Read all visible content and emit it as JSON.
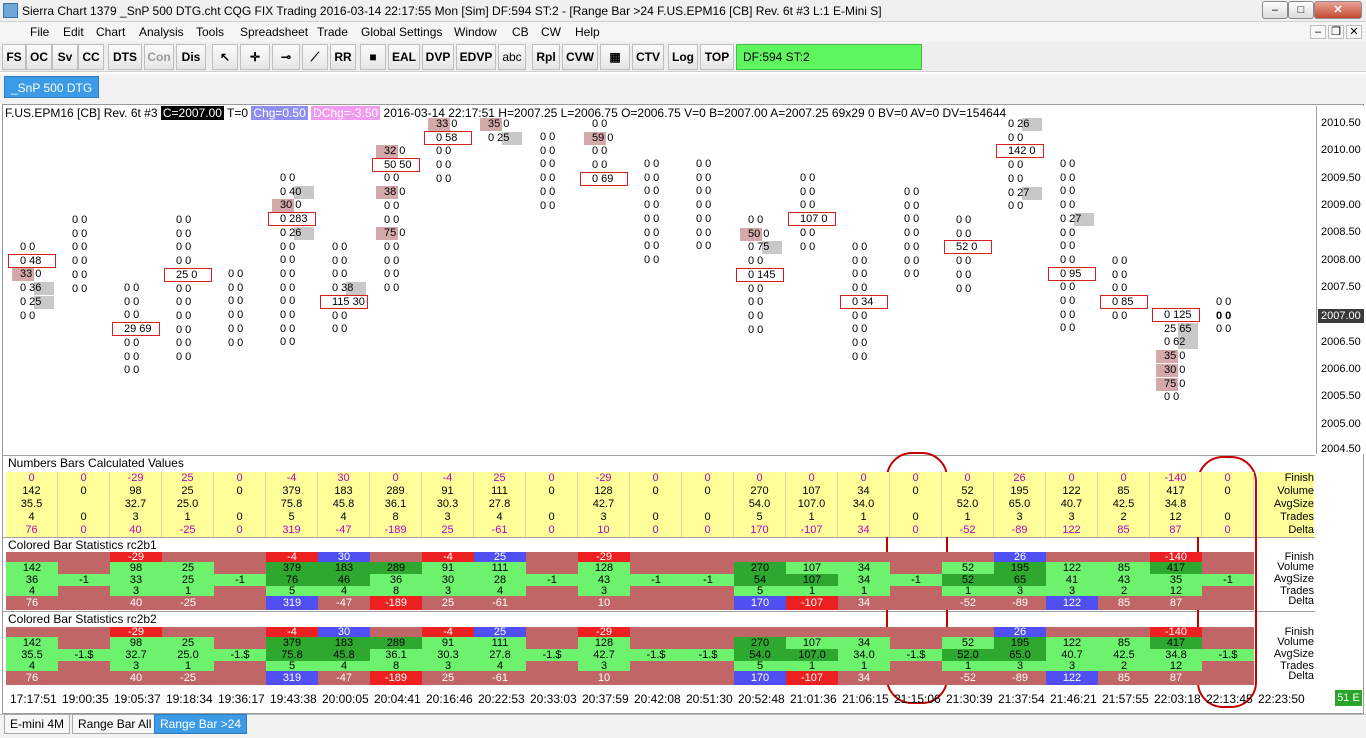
{
  "window": {
    "title": "Sierra Chart 1379 _SnP 500 DTG.cht  CQG FIX Trading 2016-03-14  22:17:55 Mon [Sim]  DF:594  ST:2 - [Range Bar >24  F.US.EPM16 [CB]  Rev. 6t  #3  L:1  E-Mini S]",
    "min_label": "–",
    "max_label": "□",
    "close_label": "✕"
  },
  "menu": [
    "File",
    "Edit",
    "Chart",
    "Analysis",
    "Tools",
    "Spreadsheet",
    "Trade",
    "Global Settings",
    "Window",
    "CB",
    "CW",
    "Help"
  ],
  "mdi_controls": [
    "–",
    "❐",
    "✕"
  ],
  "toolbar": {
    "buttons": [
      "FS",
      "OC",
      "Sv",
      "CC",
      "DTS",
      "Con",
      "Dis",
      "↖",
      "✛",
      "⊸",
      "⟋",
      "RR",
      "■",
      "EAL",
      "DVP",
      "EDVP",
      "abc",
      "Rpl",
      "CVW",
      "▦",
      "CTV",
      "Log",
      "TOP"
    ],
    "status": "DF:594  ST:2"
  },
  "chart_tab": "_SnP 500 DTG",
  "info": {
    "symbol": "F.US.EPM16 [CB]  Rev. 6t  #3",
    "close": "C=2007.00",
    "t": "T=0",
    "chg": "Chg=0.50",
    "dchg": "DChg=-3.50",
    "rest": "2016-03-14  22:17:51  H=2007.25  L=2006.75  O=2006.75  V=0  B=2007.00  A=2007.25  69x29  0  BV=0  AV=0  DV=154644"
  },
  "price_scale": {
    "labels": [
      "2010.50",
      "2010.00",
      "2009.50",
      "2009.00",
      "2008.50",
      "2008.00",
      "2007.50",
      "2006.50",
      "2006.00",
      "2005.50",
      "2005.00",
      "2004.50"
    ],
    "current": "2007.00"
  },
  "colors": {
    "accent": "#3c9be6",
    "status_green": "#5ef55e",
    "box_red": "#d62020",
    "shade": "#d4a9a9",
    "shade_gray": "#c8c8c8",
    "yellow": "#ffff99",
    "magenta": "#c000c0",
    "green_light": "#6cf26c",
    "green_dark": "#2fa82f",
    "red_cell": "#ec2020",
    "blue_cell": "#4f4ff2",
    "brown": "#c06666"
  },
  "nb": {
    "title": "Numbers Bars Calculated Values",
    "row_labels": [
      "Finish",
      "Volume",
      "AvgSize",
      "Trades",
      "Delta"
    ],
    "finish": [
      "0",
      "0",
      "-29",
      "25",
      "0",
      "-4",
      "30",
      "0",
      "-4",
      "25",
      "0",
      "-29",
      "0",
      "0",
      "0",
      "0",
      "0",
      "0",
      "0",
      "26",
      "0",
      "0",
      "-140",
      "0"
    ],
    "volume": [
      "142",
      "0",
      "98",
      "25",
      "0",
      "379",
      "183",
      "289",
      "91",
      "111",
      "0",
      "128",
      "0",
      "0",
      "270",
      "107",
      "34",
      "0",
      "52",
      "195",
      "122",
      "85",
      "417",
      "0"
    ],
    "avgsize": [
      "35.5",
      "",
      "32.7",
      "25.0",
      "",
      "75.8",
      "45.8",
      "36.1",
      "30.3",
      "27.8",
      "",
      "42.7",
      "",
      "",
      "54.0",
      "107.0",
      "34.0",
      "",
      "52.0",
      "65.0",
      "40.7",
      "42.5",
      "34.8",
      ""
    ],
    "trades": [
      "4",
      "0",
      "3",
      "1",
      "0",
      "5",
      "4",
      "8",
      "3",
      "4",
      "0",
      "3",
      "0",
      "0",
      "5",
      "1",
      "1",
      "0",
      "1",
      "3",
      "3",
      "2",
      "12",
      "0"
    ],
    "delta": [
      "76",
      "0",
      "40",
      "-25",
      "0",
      "319",
      "-47",
      "-189",
      "25",
      "-61",
      "0",
      "10",
      "0",
      "0",
      "170",
      "-107",
      "34",
      "0",
      "-52",
      "-89",
      "122",
      "85",
      "87",
      "0"
    ]
  },
  "cb1": {
    "title": "Colored Bar Statistics rc2b1",
    "row_labels": [
      "Finish",
      "Volume",
      "AvgSize",
      "Trades",
      "Delta"
    ],
    "finish": [
      "",
      "",
      "-29",
      "",
      "",
      "-4",
      "30",
      "",
      "-4",
      "25",
      "",
      "-29",
      "",
      "",
      "",
      "",
      "",
      "",
      "",
      "26",
      "",
      "",
      "-140",
      ""
    ],
    "volume": [
      "142",
      "",
      "98",
      "25",
      "",
      "379",
      "183",
      "289",
      "91",
      "111",
      "",
      "128",
      "",
      "",
      "270",
      "107",
      "34",
      "",
      "52",
      "195",
      "122",
      "85",
      "417",
      ""
    ],
    "avgsize": [
      "36",
      "-1",
      "33",
      "25",
      "-1",
      "76",
      "46",
      "36",
      "30",
      "28",
      "-1",
      "43",
      "-1",
      "-1",
      "54",
      "107",
      "34",
      "-1",
      "52",
      "65",
      "41",
      "43",
      "35",
      "-1"
    ],
    "trades": [
      "4",
      "",
      "3",
      "1",
      "",
      "5",
      "4",
      "8",
      "3",
      "4",
      "",
      "3",
      "",
      "",
      "5",
      "1",
      "1",
      "",
      "1",
      "3",
      "3",
      "2",
      "12",
      ""
    ],
    "delta": [
      "76",
      "",
      "40",
      "-25",
      "",
      "319",
      "-47",
      "-189",
      "25",
      "-61",
      "",
      "10",
      "",
      "",
      "170",
      "-107",
      "34",
      "",
      "-52",
      "-89",
      "122",
      "85",
      "87",
      ""
    ]
  },
  "cb2": {
    "title": "Colored Bar Statistics rc2b2",
    "row_labels": [
      "Finish",
      "Volume",
      "AvgSize",
      "Trades",
      "Delta"
    ],
    "finish": [
      "",
      "",
      "-29",
      "",
      "",
      "-4",
      "30",
      "",
      "-4",
      "25",
      "",
      "-29",
      "",
      "",
      "",
      "",
      "",
      "",
      "",
      "26",
      "",
      "",
      "-140",
      ""
    ],
    "volume": [
      "142",
      "",
      "98",
      "25",
      "",
      "379",
      "183",
      "289",
      "91",
      "111",
      "",
      "128",
      "",
      "",
      "270",
      "107",
      "34",
      "",
      "52",
      "195",
      "122",
      "85",
      "417",
      ""
    ],
    "avgsize": [
      "35.5",
      "-1.$",
      "32.7",
      "25.0",
      "-1.$",
      "75.8",
      "45.8",
      "36.1",
      "30.3",
      "27.8",
      "-1.$",
      "42.7",
      "-1.$",
      "-1.$",
      "54.0",
      "107.0",
      "34.0",
      "-1.$",
      "52.0",
      "65.0",
      "40.7",
      "42.5",
      "34.8",
      "-1.$"
    ],
    "trades": [
      "4",
      "",
      "3",
      "1",
      "",
      "5",
      "4",
      "8",
      "3",
      "4",
      "",
      "3",
      "",
      "",
      "5",
      "1",
      "1",
      "",
      "1",
      "3",
      "3",
      "2",
      "12",
      ""
    ],
    "delta": [
      "76",
      "",
      "40",
      "-25",
      "",
      "319",
      "-47",
      "-189",
      "25",
      "-61",
      "",
      "10",
      "",
      "",
      "170",
      "-107",
      "34",
      "",
      "-52",
      "-89",
      "122",
      "85",
      "87",
      ""
    ]
  },
  "time_labels": [
    "17:17:51",
    "19:00:35",
    "19:05:37",
    "19:18:34",
    "19:36:17",
    "19:43:38",
    "20:00:05",
    "20:04:41",
    "20:16:46",
    "20:22:53",
    "20:33:03",
    "20:37:59",
    "20:42:08",
    "20:51:30",
    "20:52:48",
    "21:01:36",
    "21:06:15",
    "21:15:06",
    "21:30:39",
    "21:37:54",
    "21:46:21",
    "21:57:55",
    "22:03:18",
    "22:13:45",
    "22:23:50"
  ],
  "clock_badge": "51 E",
  "bottom_tabs": [
    "E-mini 4M",
    "Range Bar All",
    "Range Bar >24"
  ],
  "bars": [
    {
      "cells": [
        [
          "0 0",
          ""
        ],
        [
          "0 48",
          "box"
        ],
        [
          "33 0",
          "shade-left"
        ],
        [
          "0 36",
          "shade"
        ],
        [
          "0 25",
          "shade"
        ],
        [
          "0 0",
          ""
        ]
      ]
    },
    {
      "cells": [
        [
          "0 0",
          ""
        ],
        [
          "0 0",
          ""
        ],
        [
          "0 0",
          ""
        ],
        [
          "0 0",
          ""
        ],
        [
          "0 0",
          ""
        ],
        [
          "0 0",
          ""
        ]
      ]
    },
    {
      "cells": [
        [
          "0 0",
          ""
        ],
        [
          "0 0",
          ""
        ],
        [
          "0 0",
          ""
        ],
        [
          "29 69",
          "box"
        ],
        [
          "0 0",
          ""
        ],
        [
          "0 0",
          ""
        ],
        [
          "0 0",
          ""
        ]
      ]
    },
    {
      "cells": [
        [
          "0 0",
          ""
        ],
        [
          "0 0",
          ""
        ],
        [
          "0 0",
          ""
        ],
        [
          "0 0",
          ""
        ],
        [
          "25 0",
          "box"
        ],
        [
          "0 0",
          ""
        ],
        [
          "0 0",
          ""
        ],
        [
          "0 0",
          ""
        ],
        [
          "0 0",
          ""
        ],
        [
          "0 0",
          ""
        ],
        [
          "0 0",
          ""
        ]
      ]
    },
    {
      "cells": [
        [
          "0 0",
          ""
        ],
        [
          "0 0",
          ""
        ],
        [
          "0 0",
          ""
        ],
        [
          "0 0",
          ""
        ],
        [
          "0 0",
          ""
        ],
        [
          "0 0",
          ""
        ]
      ]
    },
    {
      "cells": [
        [
          "0 0",
          ""
        ],
        [
          "0 40",
          "shade"
        ],
        [
          "30 0",
          "shade-left"
        ],
        [
          "0 283",
          "box"
        ],
        [
          "0 26",
          "shade"
        ],
        [
          "0 0",
          ""
        ],
        [
          "0 0",
          ""
        ],
        [
          "0 0",
          ""
        ],
        [
          "0 0",
          ""
        ],
        [
          "0 0",
          ""
        ],
        [
          "0 0",
          ""
        ],
        [
          "0 0",
          ""
        ],
        [
          "0 0",
          ""
        ]
      ]
    },
    {
      "cells": [
        [
          "0 0",
          ""
        ],
        [
          "0 0",
          ""
        ],
        [
          "0 0",
          ""
        ],
        [
          "0 38",
          "shade"
        ],
        [
          "115 30",
          "box"
        ],
        [
          "0 0",
          ""
        ],
        [
          "0 0",
          ""
        ]
      ]
    },
    {
      "cells": [
        [
          "32 0",
          "shade-left"
        ],
        [
          "50 50",
          "box"
        ],
        [
          "0 0",
          ""
        ],
        [
          "38 0",
          "shade-left"
        ],
        [
          "0 0",
          ""
        ],
        [
          "0 0",
          ""
        ],
        [
          "75 0",
          "shade-left"
        ],
        [
          "0 0",
          ""
        ],
        [
          "0 0",
          ""
        ],
        [
          "0 0",
          ""
        ],
        [
          "0 0",
          ""
        ]
      ]
    },
    {
      "cells": [
        [
          "33 0",
          "shade-left"
        ],
        [
          "0 58",
          "box"
        ],
        [
          "0 0",
          ""
        ],
        [
          "0 0",
          ""
        ],
        [
          "0 0",
          ""
        ]
      ]
    },
    {
      "cells": [
        [
          "35 0",
          "shade-left"
        ],
        [
          "0 25",
          "shade"
        ]
      ]
    },
    {
      "cells": [
        [
          "0 0",
          ""
        ],
        [
          "0 0",
          ""
        ],
        [
          "0 0",
          ""
        ],
        [
          "0 0",
          ""
        ],
        [
          "0 0",
          ""
        ],
        [
          "0 0",
          ""
        ]
      ]
    },
    {
      "cells": [
        [
          "0 0",
          ""
        ],
        [
          "59 0",
          "shade-left"
        ],
        [
          "0 0",
          ""
        ],
        [
          "0 0",
          ""
        ],
        [
          "0 69",
          "box"
        ]
      ]
    },
    {
      "cells": [
        [
          "0 0",
          ""
        ],
        [
          "0 0",
          ""
        ],
        [
          "0 0",
          ""
        ],
        [
          "0 0",
          ""
        ],
        [
          "0 0",
          ""
        ],
        [
          "0 0",
          ""
        ],
        [
          "0 0",
          ""
        ],
        [
          "0 0",
          ""
        ]
      ]
    },
    {
      "cells": [
        [
          "0 0",
          ""
        ],
        [
          "0 0",
          ""
        ],
        [
          "0 0",
          ""
        ],
        [
          "0 0",
          ""
        ],
        [
          "0 0",
          ""
        ],
        [
          "0 0",
          ""
        ],
        [
          "0 0",
          ""
        ]
      ]
    },
    {
      "cells": [
        [
          "0 0",
          ""
        ],
        [
          "50 0",
          "shade-left"
        ],
        [
          "0 75",
          "shade"
        ],
        [
          "0 0",
          ""
        ],
        [
          "0 145",
          "box"
        ],
        [
          "0 0",
          ""
        ],
        [
          "0 0",
          ""
        ],
        [
          "0 0",
          ""
        ],
        [
          "0 0",
          ""
        ]
      ]
    },
    {
      "cells": [
        [
          "0 0",
          ""
        ],
        [
          "0 0",
          ""
        ],
        [
          "0 0",
          ""
        ],
        [
          "107 0",
          "box"
        ],
        [
          "0 0",
          ""
        ],
        [
          "0 0",
          ""
        ]
      ]
    },
    {
      "cells": [
        [
          "0 0",
          ""
        ],
        [
          "0 0",
          ""
        ],
        [
          "0 0",
          ""
        ],
        [
          "0 0",
          ""
        ],
        [
          "0 34",
          "box"
        ],
        [
          "0 0",
          ""
        ],
        [
          "0 0",
          ""
        ],
        [
          "0 0",
          ""
        ],
        [
          "0 0",
          ""
        ]
      ]
    },
    {
      "cells": [
        [
          "0 0",
          ""
        ],
        [
          "0 0",
          ""
        ],
        [
          "0 0",
          ""
        ],
        [
          "0 0",
          ""
        ],
        [
          "0 0",
          ""
        ],
        [
          "0 0",
          ""
        ],
        [
          "0 0",
          ""
        ]
      ]
    },
    {
      "cells": [
        [
          "0 0",
          ""
        ],
        [
          "0 0",
          ""
        ],
        [
          "52 0",
          "box"
        ],
        [
          "0 0",
          ""
        ],
        [
          "0 0",
          ""
        ],
        [
          "0 0",
          ""
        ]
      ]
    },
    {
      "cells": [
        [
          "0 26",
          "shade"
        ],
        [
          "0 0",
          ""
        ],
        [
          "142 0",
          "box"
        ],
        [
          "0 0",
          ""
        ],
        [
          "0 0",
          ""
        ],
        [
          "0 27",
          "shade"
        ],
        [
          "0 0",
          ""
        ]
      ]
    },
    {
      "cells": [
        [
          "0 0",
          ""
        ],
        [
          "0 0",
          ""
        ],
        [
          "0 0",
          ""
        ],
        [
          "0 0",
          ""
        ],
        [
          "0 27",
          "shade"
        ],
        [
          "0 0",
          ""
        ],
        [
          "0 0",
          ""
        ],
        [
          "0 0",
          ""
        ],
        [
          "0 95",
          "box"
        ],
        [
          "0 0",
          ""
        ],
        [
          "0 0",
          ""
        ],
        [
          "0 0",
          ""
        ],
        [
          "0 0",
          ""
        ]
      ]
    },
    {
      "cells": [
        [
          "0 0",
          ""
        ],
        [
          "0 0",
          ""
        ],
        [
          "0 0",
          ""
        ],
        [
          "0 85",
          "box"
        ],
        [
          "0 0",
          ""
        ]
      ]
    },
    {
      "cells": [
        [
          "0 125",
          "box"
        ],
        [
          "25 65",
          "shade"
        ],
        [
          "0 62",
          "shade"
        ],
        [
          "35 0",
          "shade-left"
        ],
        [
          "30 0",
          "shade-left"
        ],
        [
          "75 0",
          "shade-left"
        ],
        [
          "0 0",
          ""
        ]
      ]
    },
    {
      "cells": [
        [
          "0 0",
          ""
        ],
        [
          "0 0",
          ""
        ],
        [
          "0 0",
          ""
        ]
      ]
    }
  ]
}
